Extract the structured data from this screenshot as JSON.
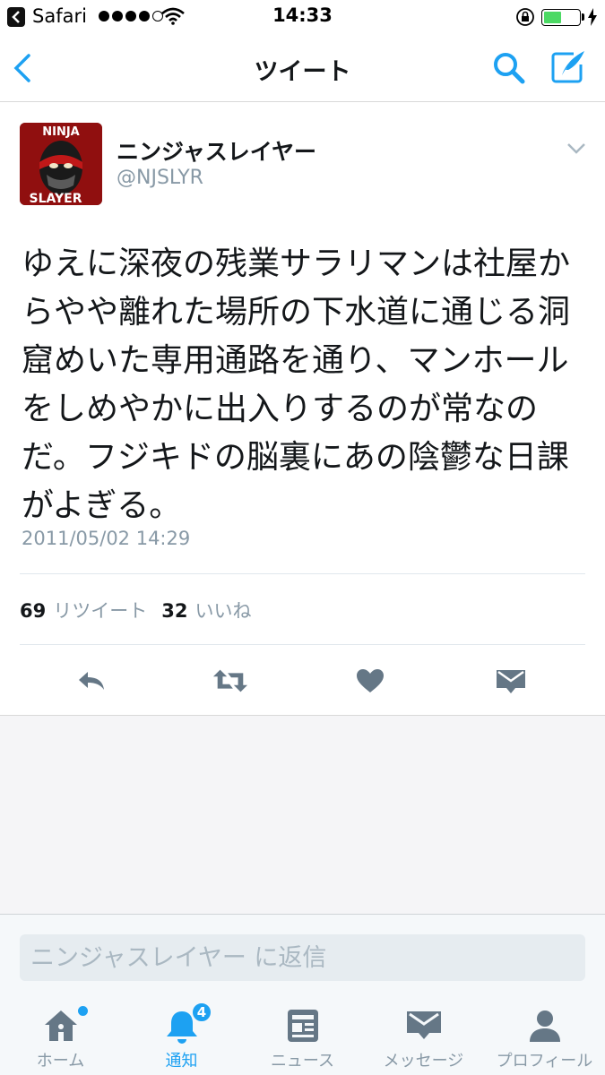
{
  "status_bar": {
    "app_name": "Safari",
    "time": "14:33",
    "battery_level": 0.5
  },
  "nav": {
    "title": "ツイート"
  },
  "tweet": {
    "display_name": "ニンジャスレイヤー",
    "handle": "@NJSLYR",
    "avatar_text_top": "NINJA",
    "avatar_text_bottom": "SLAYER",
    "text": "ゆえに深夜の残業サラリマンは社屋からやや離れた場所の下水道に通じる洞窟めいた専用通路を通り、マンホールをしめやかに出入りするのが常なのだ。フジキドの脳裏にあの陰鬱な日課がよぎる。",
    "timestamp": "2011/05/02 14:29",
    "retweet_count": "69",
    "retweet_label": "リツイート",
    "like_count": "32",
    "like_label": "いいね"
  },
  "reply": {
    "placeholder": "ニンジャスレイヤー に返信"
  },
  "tabs": [
    {
      "label": "ホーム",
      "icon": "home-icon"
    },
    {
      "label": "通知",
      "icon": "bell-icon",
      "badge": "4"
    },
    {
      "label": "ニュース",
      "icon": "news-icon"
    },
    {
      "label": "メッセージ",
      "icon": "envelope-icon"
    },
    {
      "label": "プロフィール",
      "icon": "person-icon"
    }
  ],
  "colors": {
    "accent": "#1da1f2",
    "secondary_text": "#8899a6",
    "icon_gray": "#657786"
  }
}
